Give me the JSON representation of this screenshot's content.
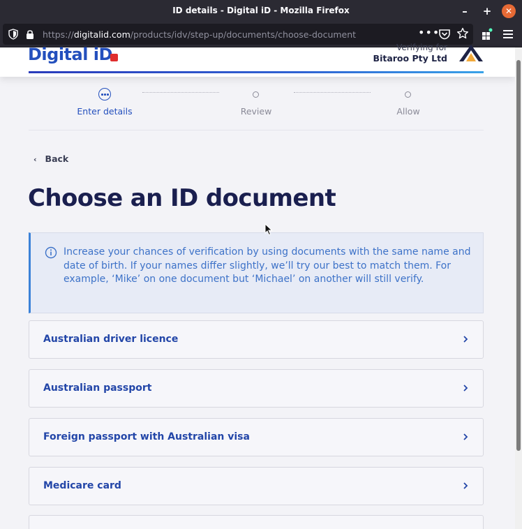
{
  "window": {
    "title": "ID details - Digital iD - Mozilla Firefox",
    "min_glyph": "–",
    "max_glyph": "+",
    "close_glyph": "✕"
  },
  "browser": {
    "url_prefix": "https://",
    "url_host": "digitalid.com",
    "url_path": "/products/idv/step-up/documents/choose-document",
    "more_glyph": "•••",
    "icons": [
      "shield-icon",
      "lock-icon",
      "pocket-icon",
      "star-icon",
      "extensions-icon",
      "menu-icon"
    ]
  },
  "header": {
    "logo_text": "Digital iD",
    "verifying_label": "Verifying for",
    "company_name": "Bitaroo Pty Ltd"
  },
  "stepper": {
    "steps": [
      {
        "label": "Enter details",
        "state": "active"
      },
      {
        "label": "Review",
        "state": "inactive"
      },
      {
        "label": "Allow",
        "state": "inactive"
      }
    ]
  },
  "back": {
    "chevron": "‹",
    "label": "Back"
  },
  "page": {
    "heading": "Choose an ID document",
    "info_text": "Increase your chances of verification by using documents with the same name and date of birth. If your names differ slightly, we’ll try our best to match them. For example, ‘Mike’ on one document but ‘Michael’ on another will still verify."
  },
  "documents": [
    {
      "label": "Australian driver licence"
    },
    {
      "label": "Australian passport"
    },
    {
      "label": "Foreign passport with Australian visa"
    },
    {
      "label": "Medicare card"
    },
    {
      "label": ""
    }
  ],
  "colors": {
    "brand_blue": "#234fbd",
    "heading_navy": "#1a1f4f",
    "info_bg": "#e7ebf6",
    "info_accent": "#3b82d8",
    "firefox_chrome": "#2b2a33",
    "close_orange": "#e66a35"
  }
}
